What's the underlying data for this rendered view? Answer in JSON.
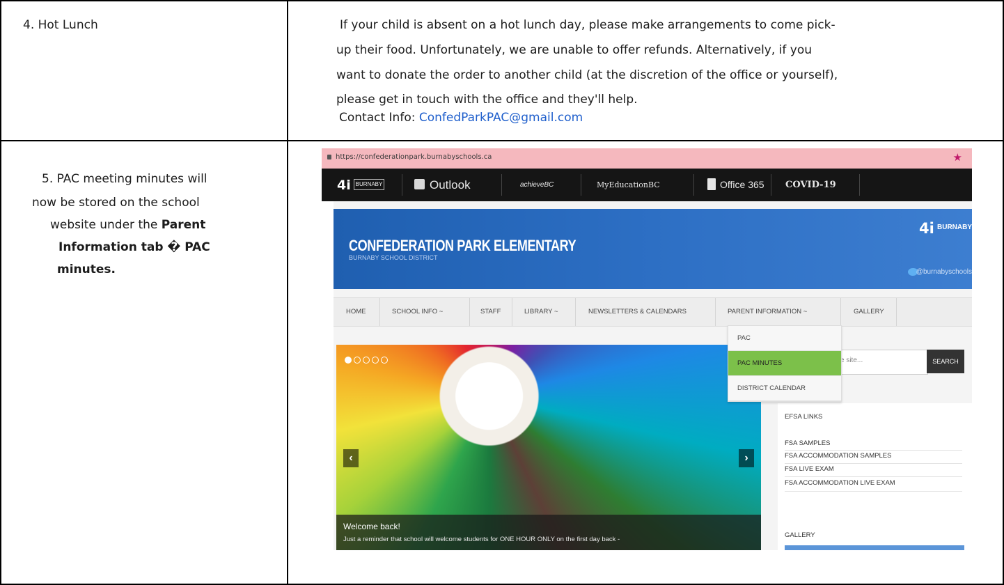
{
  "row4": {
    "label": "4. Hot Lunch",
    "lines": [
      "If your child is absent on a hot lunch day, please make arrangements to come pick-",
      "up their food. Unfortunately, we are unable to offer refunds. Alternatively, if you",
      "want to donate the order to another child (at the discretion of the office or yourself),",
      "please get in touch with the office and they'll help."
    ],
    "contact_label": "Contact Info:",
    "contact_email": "ConfedParkPAC@gmail.com"
  },
  "row5": {
    "line1": "5. PAC meeting minutes will",
    "line2": "now be stored on the school",
    "line3_plain": "website under the",
    "line3_bold": "Parent",
    "line4": "Information tab � PAC",
    "line5": "minutes."
  },
  "screenshot": {
    "url": "https://confederationpark.burnabyschools.ca",
    "topbar": {
      "burnaby": "BURNABY",
      "outlook": "Outlook",
      "achieve": "achieveBC",
      "myed": "MyEducationBC",
      "office": "Office 365",
      "covid": "COVID-19"
    },
    "school_name": "CONFEDERATION PARK ELEMENTARY",
    "district": "BURNABY SCHOOL DISTRICT",
    "logo_text": "BURNABY",
    "twitter": "@burnabyschools",
    "nav": [
      "HOME",
      "SCHOOL INFO ~",
      "STAFF",
      "LIBRARY ~",
      "NEWSLETTERS & CALENDARS",
      "PARENT INFORMATION ~",
      "GALLERY"
    ],
    "dropdown": [
      "PAC",
      "PAC MINUTES",
      "DISTRICT CALENDAR"
    ],
    "search_placeholder": "e site...",
    "search_button": "SEARCH",
    "sidebar": {
      "efsa": "EFSA LINKS",
      "links": [
        "FSA SAMPLES",
        "FSA ACCOMMODATION SAMPLES",
        "FSA LIVE EXAM",
        "FSA ACCOMMODATION LIVE EXAM"
      ],
      "gallery": "GALLERY"
    },
    "caption_title": "Welcome back!",
    "caption_text": "Just a reminder that school will welcome students for ONE HOUR ONLY on the first day back -"
  }
}
